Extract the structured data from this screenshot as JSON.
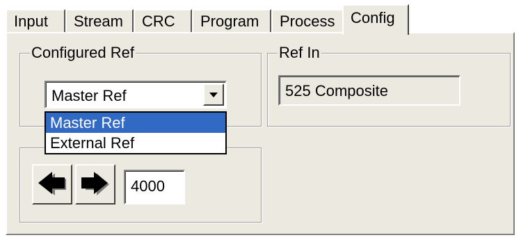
{
  "tabs": [
    {
      "label": "Input"
    },
    {
      "label": "Stream"
    },
    {
      "label": "CRC"
    },
    {
      "label": "Program"
    },
    {
      "label": "Process"
    },
    {
      "label": "Config"
    }
  ],
  "active_tab": "Config",
  "configured_ref": {
    "group_label": "Configured Ref",
    "selected": "Master Ref",
    "options": [
      {
        "label": "Master Ref",
        "highlighted": true
      },
      {
        "label": "External Ref",
        "highlighted": false
      }
    ]
  },
  "ref_in": {
    "group_label": "Ref In",
    "value": "525 Composite"
  },
  "crc_pid": {
    "value": "4000",
    "decrement_icon": "left-arrow-icon",
    "increment_icon": "right-arrow-icon"
  },
  "colors": {
    "face": "#eceae0",
    "highlight": "#316ac5"
  }
}
